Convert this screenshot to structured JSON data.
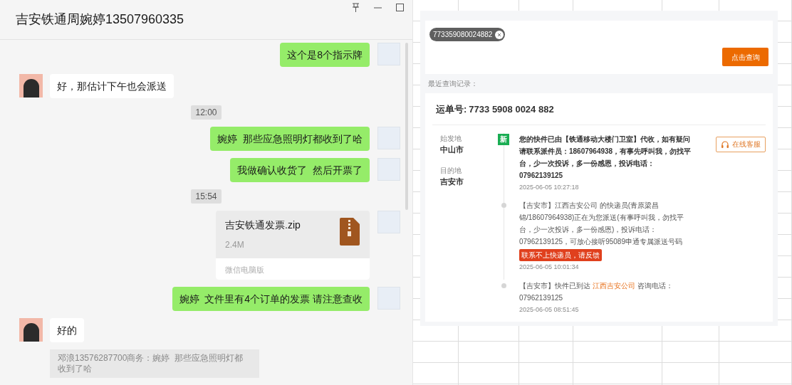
{
  "window": {
    "title": "吉安铁通周婉婷13507960335"
  },
  "messages": [
    {
      "kind": "text",
      "outgoing": true,
      "text": "这个是8个指示牌"
    },
    {
      "kind": "text",
      "outgoing": false,
      "text": "好，那估计下午也会派送"
    },
    {
      "kind": "time",
      "text": "12:00"
    },
    {
      "kind": "text",
      "outgoing": true,
      "text": "婉婷  那些应急照明灯都收到了哈"
    },
    {
      "kind": "text",
      "outgoing": true,
      "text": "我做确认收货了  然后开票了"
    },
    {
      "kind": "time",
      "text": "15:54"
    },
    {
      "kind": "file",
      "outgoing": true,
      "name": "吉安铁通发票.zip",
      "size": "2.4M",
      "source": "微信电脑版"
    },
    {
      "kind": "text",
      "outgoing": true,
      "text": "婉婷  文件里有4个订单的发票 请注意查收"
    },
    {
      "kind": "text",
      "outgoing": false,
      "text": "好的"
    },
    {
      "kind": "quote",
      "text": "邓浪13576287700商务：婉婷  那些应急照明灯都收到了哈"
    }
  ],
  "tracking": {
    "search": {
      "tag": "773359080024882",
      "button": "点击查询"
    },
    "recent_label": "最近查询记录：",
    "waybill_label": "运单号:",
    "waybill": "7733 5908 0024 882",
    "origin_label": "始发地",
    "origin": "中山市",
    "destination_label": "目的地",
    "destination": "吉安市",
    "service_button": "在线客服",
    "events": [
      {
        "kind": "latest",
        "badge": "新",
        "parts": [
          {
            "kind": "plain",
            "text": "您的快件已由【铁通移动大楼门卫室】代收，如有疑问请联系派件员：18607964938，有事先呼叫我，勿找平台，少一次投诉，多一份感恩，投诉电话：07962139125"
          }
        ],
        "time": "2025-06-05 10:27:18"
      },
      {
        "kind": "normal",
        "parts": [
          {
            "kind": "plain",
            "text": "【吉安市】江西吉安公司 的快递员(青原梁昌锦/18607964938)正在为您派送(有事呼叫我，勿找平台，少一次投诉，多一份感恩)，投诉电话：07962139125，可放心接听95089申通专属派送号码"
          }
        ],
        "tag": "联系不上快递员，请反馈",
        "time": "2025-06-05 10:01:34"
      },
      {
        "kind": "normal",
        "parts": [
          {
            "kind": "plain",
            "text": "【吉安市】快件已到达 "
          },
          {
            "kind": "link",
            "text": "江西吉安公司"
          },
          {
            "kind": "plain",
            "text": " 咨询电话：07962139125"
          }
        ],
        "time": "2025-06-05 08:51:45"
      }
    ]
  }
}
